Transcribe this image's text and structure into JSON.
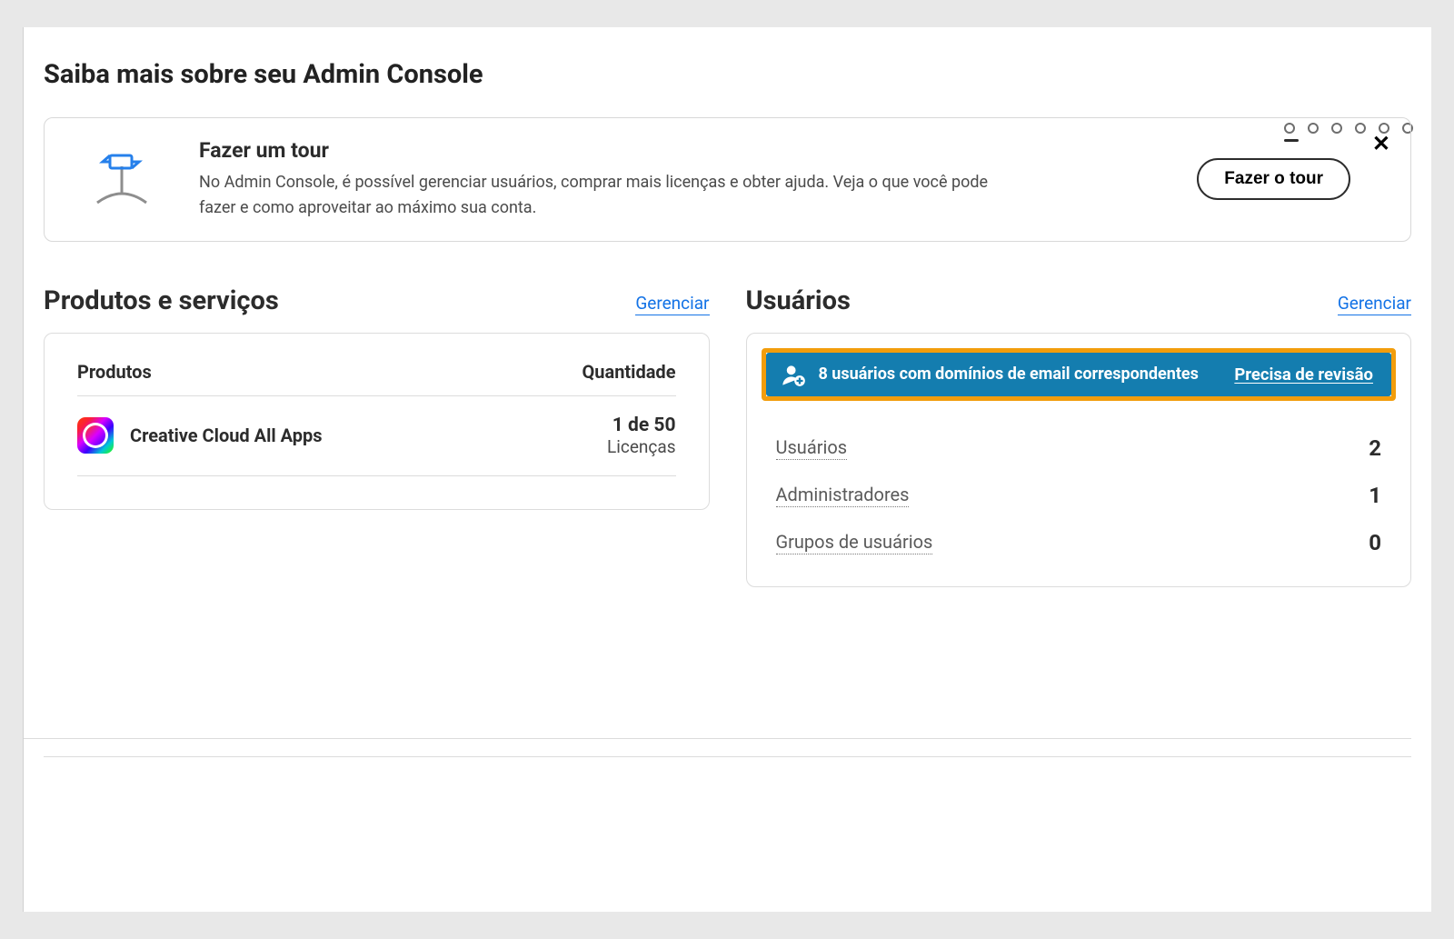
{
  "page": {
    "title": "Saiba mais sobre seu Admin Console"
  },
  "tour": {
    "title": "Fazer um tour",
    "description": "No Admin Console, é possível gerenciar usuários, comprar mais licenças e obter ajuda. Veja o que você pode fazer e como aproveitar ao máximo sua conta.",
    "button": "Fazer o tour",
    "close_aria": "Fechar"
  },
  "products": {
    "heading": "Produtos e serviços",
    "manage": "Gerenciar",
    "columns": {
      "product": "Produtos",
      "qty": "Quantidade"
    },
    "rows": [
      {
        "name": "Creative Cloud All Apps",
        "count": "1 de 50",
        "unit": "Licenças"
      }
    ]
  },
  "users": {
    "heading": "Usuários",
    "manage": "Gerenciar",
    "banner": {
      "text": "8 usuários com domínios de email correspondentes",
      "link": "Precisa de revisão"
    },
    "rows": [
      {
        "label": "Usuários",
        "count": "2"
      },
      {
        "label": "Administradores",
        "count": "1"
      },
      {
        "label": "Grupos de usuários",
        "count": "0"
      }
    ]
  },
  "carousel": {
    "slides": 6,
    "active": 0
  }
}
